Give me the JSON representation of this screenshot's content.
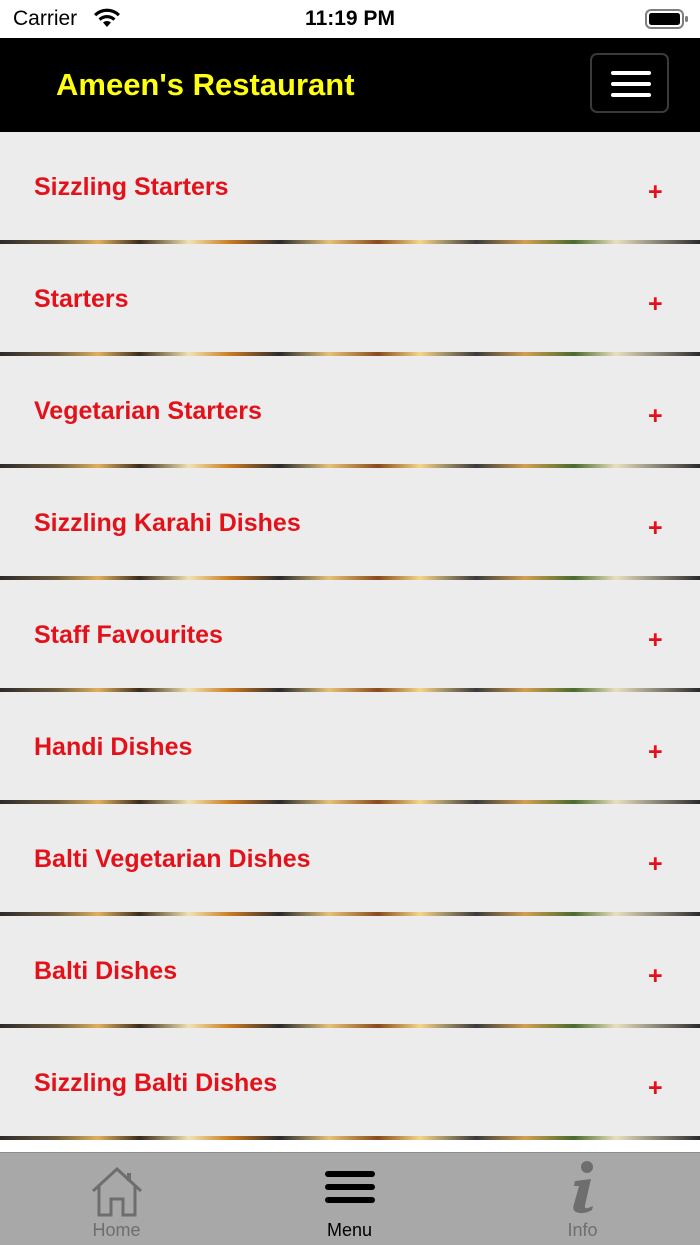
{
  "status_bar": {
    "carrier": "Carrier",
    "time": "11:19 PM"
  },
  "header": {
    "title": "Ameen's Restaurant",
    "title_color": "#ffff11",
    "background": "#000000"
  },
  "categories": [
    {
      "label": "Sizzling Starters",
      "expand": "+"
    },
    {
      "label": "Starters",
      "expand": "+"
    },
    {
      "label": "Vegetarian Starters",
      "expand": "+"
    },
    {
      "label": "Sizzling Karahi Dishes",
      "expand": "+"
    },
    {
      "label": "Staff Favourites",
      "expand": "+"
    },
    {
      "label": "Handi Dishes",
      "expand": "+"
    },
    {
      "label": "Balti Vegetarian Dishes",
      "expand": "+"
    },
    {
      "label": "Balti Dishes",
      "expand": "+"
    },
    {
      "label": "Sizzling Balti Dishes",
      "expand": "+"
    }
  ],
  "category_color": "#e3121a",
  "tab_bar": {
    "tabs": [
      {
        "label": "Home",
        "icon": "home-icon",
        "active": false
      },
      {
        "label": "Menu",
        "icon": "menu-icon",
        "active": true
      },
      {
        "label": "Info",
        "icon": "info-icon",
        "active": false
      }
    ]
  }
}
